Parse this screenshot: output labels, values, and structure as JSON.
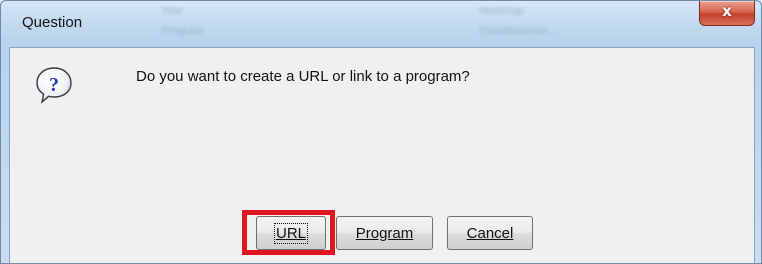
{
  "dialog": {
    "title": "Question",
    "close_glyph": "x",
    "message": "Do you want to create a URL or link to a program?",
    "icon": "question-bubble-icon"
  },
  "background_window": {
    "blurred_labels": [
      "Year",
      "Program",
      "Heatmap",
      "Crashbouncer..."
    ]
  },
  "buttons": {
    "url_label": "URL",
    "program_label": "Program",
    "cancel_label": "Cancel"
  },
  "colors": {
    "highlight": "#e0141e",
    "close_button": "#c7412a"
  }
}
